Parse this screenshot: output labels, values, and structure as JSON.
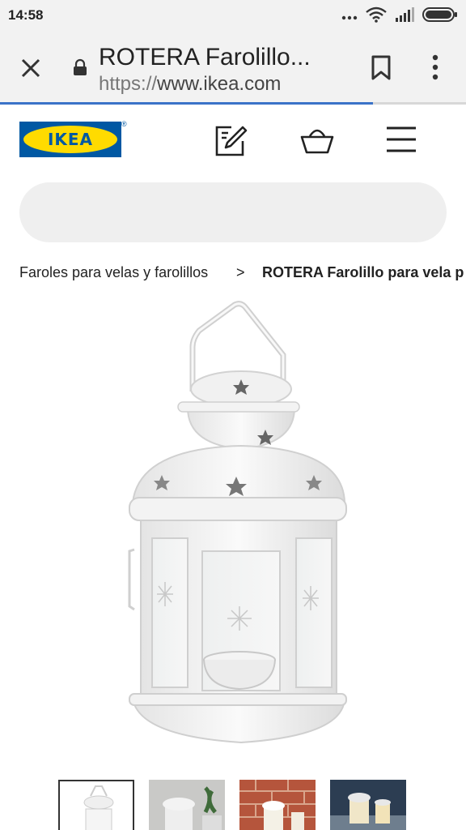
{
  "status_bar": {
    "time": "14:58"
  },
  "browser": {
    "page_title": "ROTERA Farolillo...",
    "url_scheme": "https://",
    "url_host": "www.ikea.com",
    "load_progress": 0.8
  },
  "header": {
    "logo_text": "IKEA",
    "logo_registered": "®"
  },
  "search": {
    "placeholder": ""
  },
  "breadcrumb": {
    "parent": "Faroles para velas y farolillos",
    "separator": ">",
    "current": "ROTERA Farolillo para vela p"
  },
  "colors": {
    "ikea_blue": "#0058a3",
    "ikea_yellow": "#ffdb00",
    "progress": "#3b73c8"
  }
}
